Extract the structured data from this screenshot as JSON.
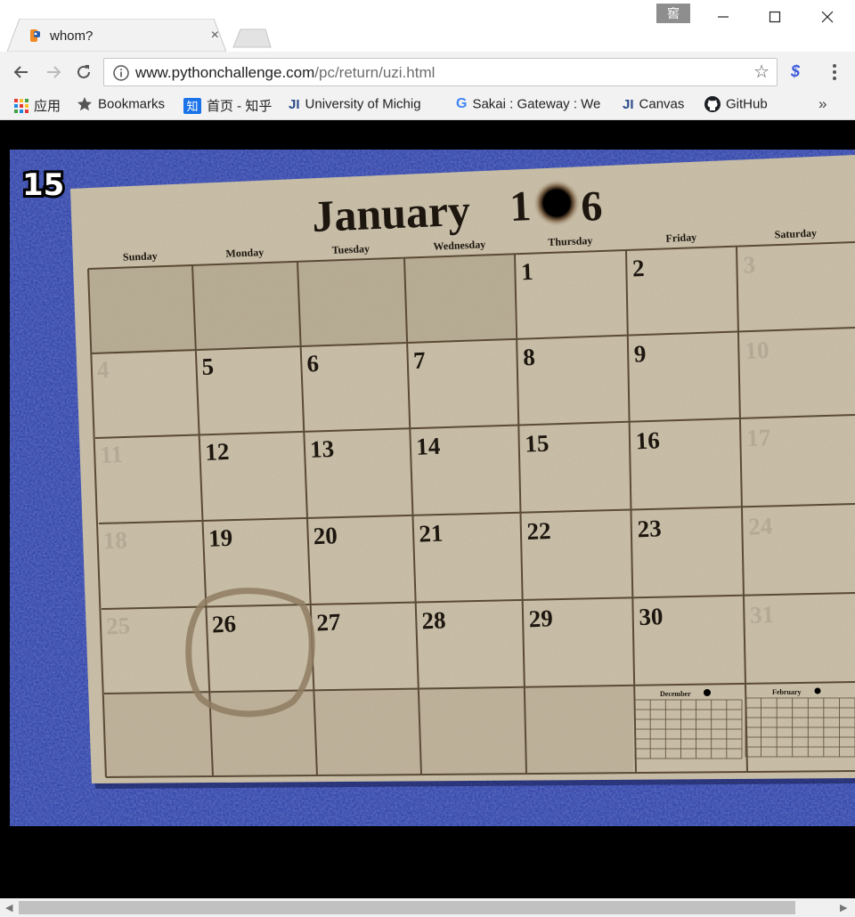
{
  "browser": {
    "tab_title": "whom?",
    "tab_close": "×",
    "profile_badge": "窖",
    "url_host": "www.pythonchallenge.com",
    "url_path": "/pc/return/uzi.html"
  },
  "bookmarks": {
    "items": [
      {
        "label": "应用",
        "icon": "apps-grid-icon"
      },
      {
        "label": "Bookmarks",
        "icon": "star-icon"
      },
      {
        "label": "首页 - 知乎",
        "icon": "zhihu-icon"
      },
      {
        "label": "University of Michig",
        "icon": "ji-icon"
      },
      {
        "label": "Sakai : Gateway : We",
        "icon": "google-icon"
      },
      {
        "label": "Canvas",
        "icon": "ji-icon"
      },
      {
        "label": "GitHub",
        "icon": "github-icon"
      }
    ],
    "overflow": "»"
  },
  "puzzle": {
    "level_number": "15",
    "month": "January",
    "year_digits_left": "1",
    "year_digits_right": "6",
    "weekdays": [
      "Sunday",
      "Monday",
      "Tuesday",
      "Wednesday",
      "Thursday",
      "Friday",
      "Saturday"
    ],
    "weeks": [
      [
        "",
        "",
        "",
        "",
        "1",
        "2",
        "3"
      ],
      [
        "4",
        "5",
        "6",
        "7",
        "8",
        "9",
        "10"
      ],
      [
        "11",
        "12",
        "13",
        "14",
        "15",
        "16",
        "17"
      ],
      [
        "18",
        "19",
        "20",
        "21",
        "22",
        "23",
        "24"
      ],
      [
        "25",
        "26",
        "27",
        "28",
        "29",
        "30",
        "31"
      ]
    ],
    "circled_day": "26",
    "mini_left_title": "December",
    "mini_right_title": "February"
  },
  "colors": {
    "background_blue": "#2f3e9e",
    "paper": "#cfc4ad",
    "ink": "#1c160f",
    "grid_line": "#5a4a36",
    "faded_digit": "#b3a994"
  }
}
